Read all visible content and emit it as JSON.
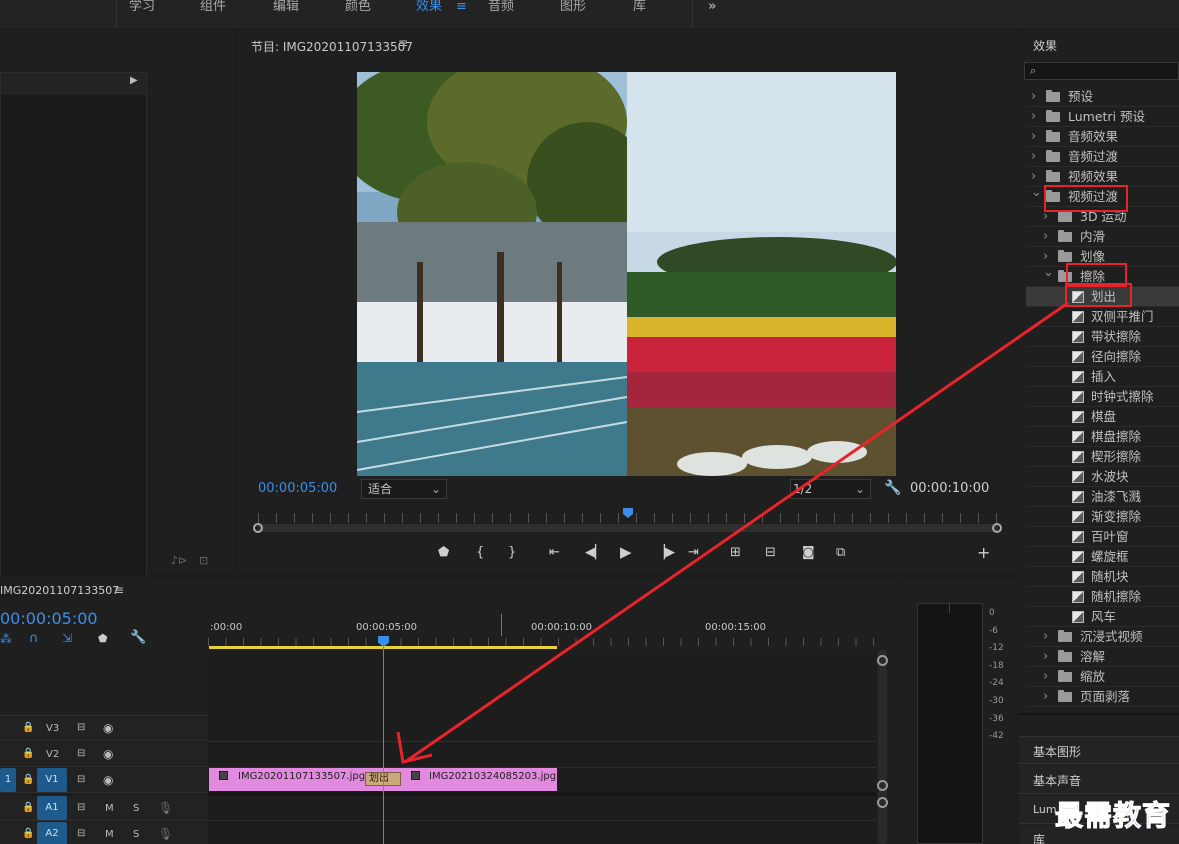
{
  "workspaces": [
    "学习",
    "组件",
    "编辑",
    "颜色",
    "效果",
    "音频",
    "图形",
    "库"
  ],
  "workspace_active_index": 4,
  "program_monitor": {
    "title": "节目: IMG20201107133507",
    "timecode_current": "00:00:05:00",
    "fit_label": "适合",
    "resolution_label": "1/2",
    "timecode_end": "00:00:10:00",
    "playhead_fraction": 0.5
  },
  "timeline": {
    "sequence_name": "IMG20201107133507",
    "timecode": "00:00:05:00",
    "ruler_labels": [
      ":00:00",
      "00:00:05:00",
      "00:00:10:00",
      "00:00:15:00"
    ],
    "tracks": [
      {
        "name": "V3"
      },
      {
        "name": "V2"
      },
      {
        "name": "V1"
      },
      {
        "name": "A1"
      },
      {
        "name": "A2"
      }
    ],
    "clip1": "IMG20201107133507.jpg",
    "clip2": "IMG20210324085203.jpg",
    "transition_label": "划出",
    "v1_src": "1",
    "m_label": "M",
    "s_label": "S"
  },
  "meter_labels": [
    "0",
    "-6",
    "-12",
    "-18",
    "-24",
    "-30",
    "-36",
    "-42"
  ],
  "effects": {
    "panel_title": "效果",
    "items": [
      {
        "label": "预设",
        "kind": "preset"
      },
      {
        "label": "Lumetri 预设",
        "kind": "preset"
      },
      {
        "label": "音频效果",
        "kind": "folder"
      },
      {
        "label": "音频过渡",
        "kind": "folder"
      },
      {
        "label": "视频效果",
        "kind": "folder"
      },
      {
        "label": "视频过渡",
        "kind": "folder",
        "expanded": true
      },
      {
        "label": "3D 运动",
        "kind": "subfolder"
      },
      {
        "label": "内滑",
        "kind": "subfolder"
      },
      {
        "label": "划像",
        "kind": "subfolder"
      },
      {
        "label": "擦除",
        "kind": "subfolder",
        "expanded": true
      },
      {
        "label": "划出",
        "kind": "effect",
        "selected": true
      },
      {
        "label": "双侧平推门",
        "kind": "effect"
      },
      {
        "label": "带状擦除",
        "kind": "effect"
      },
      {
        "label": "径向擦除",
        "kind": "effect"
      },
      {
        "label": "插入",
        "kind": "effect"
      },
      {
        "label": "时钟式擦除",
        "kind": "effect"
      },
      {
        "label": "棋盘",
        "kind": "effect"
      },
      {
        "label": "棋盘擦除",
        "kind": "effect"
      },
      {
        "label": "楔形擦除",
        "kind": "effect"
      },
      {
        "label": "水波块",
        "kind": "effect"
      },
      {
        "label": "油漆飞溅",
        "kind": "effect"
      },
      {
        "label": "渐变擦除",
        "kind": "effect"
      },
      {
        "label": "百叶窗",
        "kind": "effect"
      },
      {
        "label": "螺旋框",
        "kind": "effect"
      },
      {
        "label": "随机块",
        "kind": "effect"
      },
      {
        "label": "随机擦除",
        "kind": "effect"
      },
      {
        "label": "风车",
        "kind": "effect"
      },
      {
        "label": "沉浸式视频",
        "kind": "subfolder"
      },
      {
        "label": "溶解",
        "kind": "subfolder"
      },
      {
        "label": "缩放",
        "kind": "subfolder"
      },
      {
        "label": "页面剥落",
        "kind": "subfolder"
      }
    ]
  },
  "side_panels": [
    "基本图形",
    "基本声音",
    "Lum",
    "库"
  ],
  "watermark": "最需教育",
  "colors": {
    "accent": "#3b8eea",
    "clip": "#e28ae0",
    "annotation": "#e8242a",
    "work_area": "#e8d23a"
  }
}
